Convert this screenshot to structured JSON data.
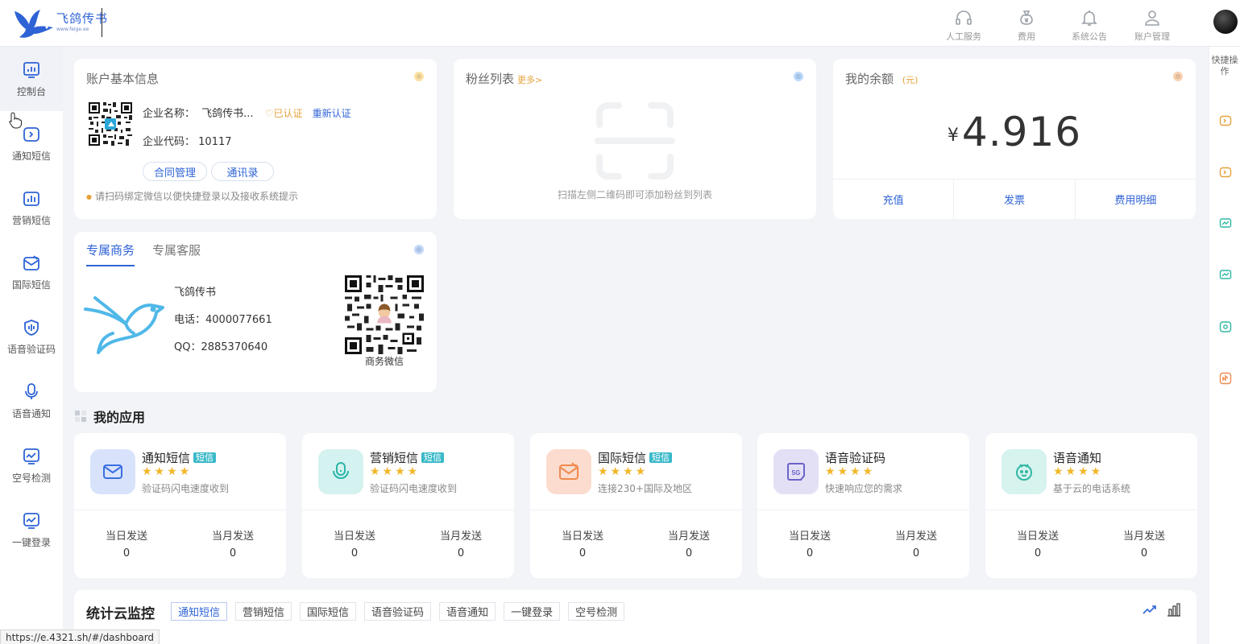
{
  "brand": {
    "cn": "飞鸽传书",
    "en": "www.feige.ee"
  },
  "header": {
    "items": [
      {
        "label": "人工服务",
        "icon": "headset-icon"
      },
      {
        "label": "费用",
        "icon": "money-bag-icon"
      },
      {
        "label": "系统公告",
        "icon": "bell-icon"
      },
      {
        "label": "账户管理",
        "icon": "user-icon"
      }
    ]
  },
  "sidebar": {
    "items": [
      {
        "label": "控制台",
        "icon": "dashboard-icon",
        "active": true
      },
      {
        "label": "通知短信",
        "icon": "notify-sms-icon"
      },
      {
        "label": "营销短信",
        "icon": "marketing-sms-icon"
      },
      {
        "label": "国际短信",
        "icon": "intl-sms-icon"
      },
      {
        "label": "语音验证码",
        "icon": "voice-code-icon"
      },
      {
        "label": "语音通知",
        "icon": "voice-notify-icon"
      },
      {
        "label": "空号检测",
        "icon": "empty-number-icon"
      },
      {
        "label": "一键登录",
        "icon": "one-click-login-icon"
      }
    ]
  },
  "quick_actions": {
    "title": "快捷操作"
  },
  "account": {
    "title": "账户基本信息",
    "company_label": "企业名称：",
    "company_name": "飞鸽传书...",
    "verified": "已认证",
    "recertify": "重新认证",
    "code_label": "企业代码：",
    "code": "10117",
    "buttons": [
      "合同管理",
      "通讯录"
    ],
    "hint": "请扫码绑定微信以便快捷登录以及接收系统提示",
    "dot_color": "#f5b82e"
  },
  "fans": {
    "title": "粉丝列表",
    "more": "更多>",
    "empty_text": "扫描左侧二维码即可添加粉丝到列表",
    "dot_color": "#1e7ef0"
  },
  "balance": {
    "title": "我的余额",
    "unit": "(元)",
    "currency": "¥",
    "amount": "4.916",
    "actions": [
      "充值",
      "发票",
      "费用明细"
    ],
    "dot_color": "#e07a1f"
  },
  "contact": {
    "tabs": [
      "专属商务",
      "专属客服"
    ],
    "name": "飞鸽传书",
    "phone": "电话：4000077661",
    "qq": "QQ：2885370640",
    "qr_label": "商务微信",
    "dot_color": "#3a7be8"
  },
  "apps": {
    "title": "我的应用",
    "stat_labels": [
      "当日发送",
      "当月发送"
    ],
    "items": [
      {
        "name": "通知短信",
        "tag": "短信",
        "desc": "验证码闪电速度收到",
        "stars": "★★★★",
        "today": "0",
        "month": "0",
        "icon": "envelope-icon",
        "bg": "#d8e3fb",
        "fg": "#3b6fe0"
      },
      {
        "name": "营销短信",
        "tag": "短信",
        "desc": "验证码闪电速度收到",
        "stars": "★★★★",
        "today": "0",
        "month": "0",
        "icon": "microphone-icon",
        "bg": "#d4f2ef",
        "fg": "#2bb5a8"
      },
      {
        "name": "国际短信",
        "tag": "短信",
        "desc": "连接230+国际及地区",
        "stars": "★★★★",
        "today": "0",
        "month": "0",
        "icon": "globe-mail-icon",
        "bg": "#fcdccf",
        "fg": "#ef8a4e"
      },
      {
        "name": "语音验证码",
        "tag": "",
        "desc": "快速响应您的需求",
        "stars": "★★★★",
        "today": "0",
        "month": "0",
        "icon": "5g-icon",
        "bg": "#e3e0f6",
        "fg": "#6b63c9"
      },
      {
        "name": "语音通知",
        "tag": "",
        "desc": "基于云的电话系统",
        "stars": "★★★★",
        "today": "0",
        "month": "0",
        "icon": "robot-face-icon",
        "bg": "#d6f3ee",
        "fg": "#2fb8a3"
      }
    ]
  },
  "monitor": {
    "title": "统计云监控",
    "tabs": [
      "通知短信",
      "营销短信",
      "国际短信",
      "语音验证码",
      "语音通知",
      "一键登录",
      "空号检测"
    ]
  },
  "status_url": "https://e.4321.sh/#/dashboard"
}
